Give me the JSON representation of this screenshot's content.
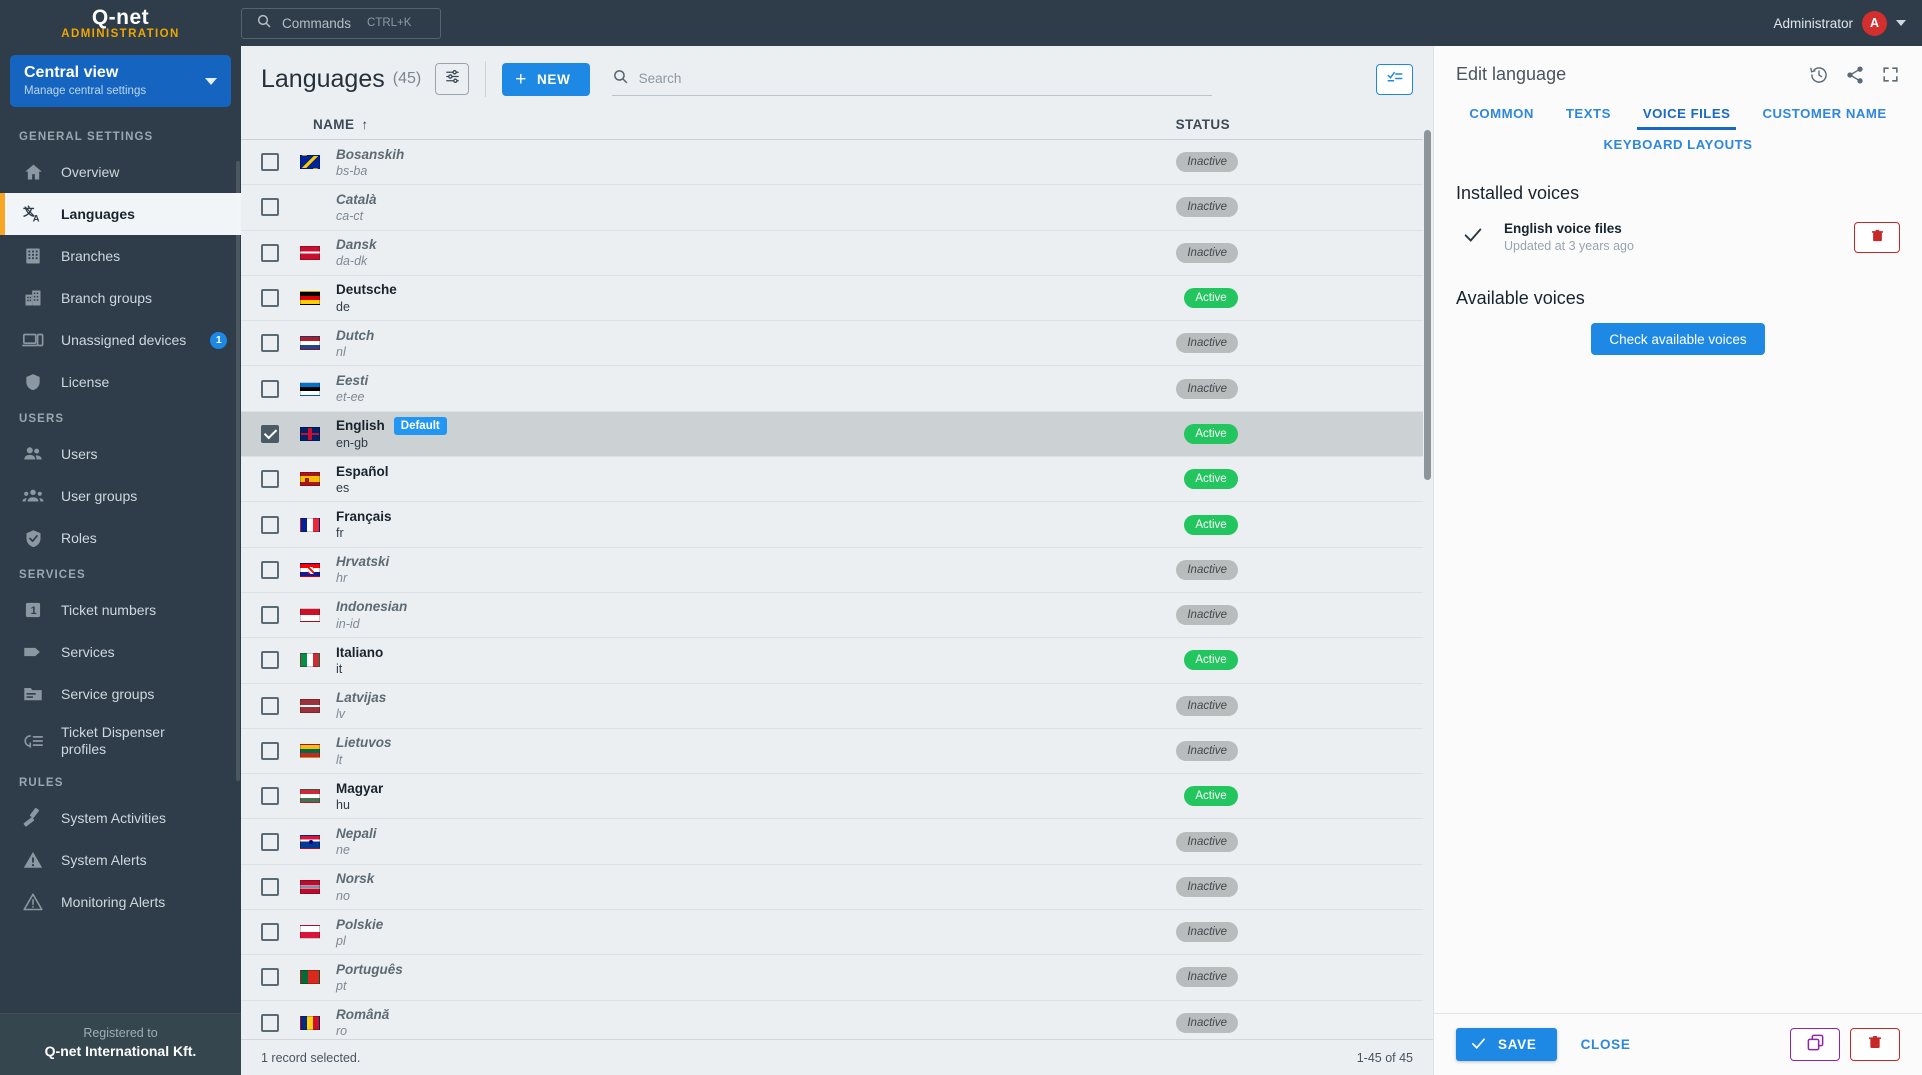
{
  "topbar": {
    "logo": "Q-net",
    "logo_sub": "ADMINISTRATION",
    "commands_label": "Commands",
    "commands_shortcut": "CTRL+K",
    "user_name": "Administrator",
    "avatar_initial": "A"
  },
  "sidebar": {
    "view_title": "Central view",
    "view_subtitle": "Manage central settings",
    "sections": [
      {
        "title": "GENERAL SETTINGS",
        "items": [
          {
            "label": "Overview",
            "icon": "home-icon",
            "active": false
          },
          {
            "label": "Languages",
            "icon": "translate-icon",
            "active": true
          },
          {
            "label": "Branches",
            "icon": "building-icon",
            "active": false
          },
          {
            "label": "Branch groups",
            "icon": "buildings-icon",
            "active": false
          },
          {
            "label": "Unassigned devices",
            "icon": "devices-icon",
            "active": false,
            "badge": "1"
          },
          {
            "label": "License",
            "icon": "shield-icon",
            "active": false
          }
        ]
      },
      {
        "title": "USERS",
        "items": [
          {
            "label": "Users",
            "icon": "users-icon",
            "active": false
          },
          {
            "label": "User groups",
            "icon": "user-group-icon",
            "active": false
          },
          {
            "label": "Roles",
            "icon": "shield-check-icon",
            "active": false
          }
        ]
      },
      {
        "title": "SERVICES",
        "items": [
          {
            "label": "Ticket numbers",
            "icon": "ticket-number-icon",
            "active": false
          },
          {
            "label": "Services",
            "icon": "tag-icon",
            "active": false
          },
          {
            "label": "Service groups",
            "icon": "folder-icon",
            "active": false
          },
          {
            "label": "Ticket Dispenser profiles",
            "icon": "dispenser-icon",
            "active": false,
            "twoline": true
          }
        ]
      },
      {
        "title": "RULES",
        "items": [
          {
            "label": "System Activities",
            "icon": "activity-icon",
            "active": false
          },
          {
            "label": "System Alerts",
            "icon": "alert-filled-icon",
            "active": false
          },
          {
            "label": "Monitoring Alerts",
            "icon": "alert-outline-icon",
            "active": false
          }
        ]
      }
    ],
    "footer_label": "Registered to",
    "footer_value": "Q-net International Kft."
  },
  "main": {
    "title": "Languages",
    "count": "(45)",
    "new_button": "NEW",
    "search_placeholder": "Search",
    "search_value": "",
    "columns": {
      "name": "NAME",
      "status": "STATUS"
    },
    "sort_indicator": "↑",
    "status_left": "1 record selected.",
    "status_right": "1-45 of 45",
    "default_badge": "Default",
    "status_active": "Active",
    "status_inactive": "Inactive",
    "rows": [
      {
        "name": "Bosanskih",
        "code": "bs-ba",
        "status": "Inactive",
        "flag": "ba",
        "selected": false,
        "default": false
      },
      {
        "name": "Català",
        "code": "ca-ct",
        "status": "Inactive",
        "flag": "none",
        "selected": false,
        "default": false
      },
      {
        "name": "Dansk",
        "code": "da-dk",
        "status": "Inactive",
        "flag": "dk",
        "selected": false,
        "default": false
      },
      {
        "name": "Deutsche",
        "code": "de",
        "status": "Active",
        "flag": "de",
        "selected": false,
        "default": false
      },
      {
        "name": "Dutch",
        "code": "nl",
        "status": "Inactive",
        "flag": "nl",
        "selected": false,
        "default": false
      },
      {
        "name": "Eesti",
        "code": "et-ee",
        "status": "Inactive",
        "flag": "ee",
        "selected": false,
        "default": false
      },
      {
        "name": "English",
        "code": "en-gb",
        "status": "Active",
        "flag": "gb",
        "selected": true,
        "default": true
      },
      {
        "name": "Español",
        "code": "es",
        "status": "Active",
        "flag": "es",
        "selected": false,
        "default": false
      },
      {
        "name": "Français",
        "code": "fr",
        "status": "Active",
        "flag": "fr",
        "selected": false,
        "default": false
      },
      {
        "name": "Hrvatski",
        "code": "hr",
        "status": "Inactive",
        "flag": "hr",
        "selected": false,
        "default": false
      },
      {
        "name": "Indonesian",
        "code": "in-id",
        "status": "Inactive",
        "flag": "id",
        "selected": false,
        "default": false
      },
      {
        "name": "Italiano",
        "code": "it",
        "status": "Active",
        "flag": "it",
        "selected": false,
        "default": false
      },
      {
        "name": "Latvijas",
        "code": "lv",
        "status": "Inactive",
        "flag": "lv",
        "selected": false,
        "default": false
      },
      {
        "name": "Lietuvos",
        "code": "lt",
        "status": "Inactive",
        "flag": "lt",
        "selected": false,
        "default": false
      },
      {
        "name": "Magyar",
        "code": "hu",
        "status": "Active",
        "flag": "hu",
        "selected": false,
        "default": false
      },
      {
        "name": "Nepali",
        "code": "ne",
        "status": "Inactive",
        "flag": "np",
        "selected": false,
        "default": false
      },
      {
        "name": "Norsk",
        "code": "no",
        "status": "Inactive",
        "flag": "no",
        "selected": false,
        "default": false
      },
      {
        "name": "Polskie",
        "code": "pl",
        "status": "Inactive",
        "flag": "pl",
        "selected": false,
        "default": false
      },
      {
        "name": "Português",
        "code": "pt",
        "status": "Inactive",
        "flag": "pt",
        "selected": false,
        "default": false
      },
      {
        "name": "Română",
        "code": "ro",
        "status": "Inactive",
        "flag": "ro",
        "selected": false,
        "default": false
      }
    ]
  },
  "panel": {
    "title": "Edit language",
    "tabs_row1": [
      "COMMON",
      "TEXTS",
      "VOICE FILES",
      "CUSTOMER NAME"
    ],
    "tabs_row2": [
      "KEYBOARD LAYOUTS"
    ],
    "selected_tab": "VOICE FILES",
    "installed_heading": "Installed voices",
    "installed_voice_name": "English voice files",
    "installed_voice_meta": "Updated at 3 years ago",
    "available_heading": "Available voices",
    "check_button": "Check available voices",
    "save_button": "SAVE",
    "close_button": "CLOSE"
  }
}
